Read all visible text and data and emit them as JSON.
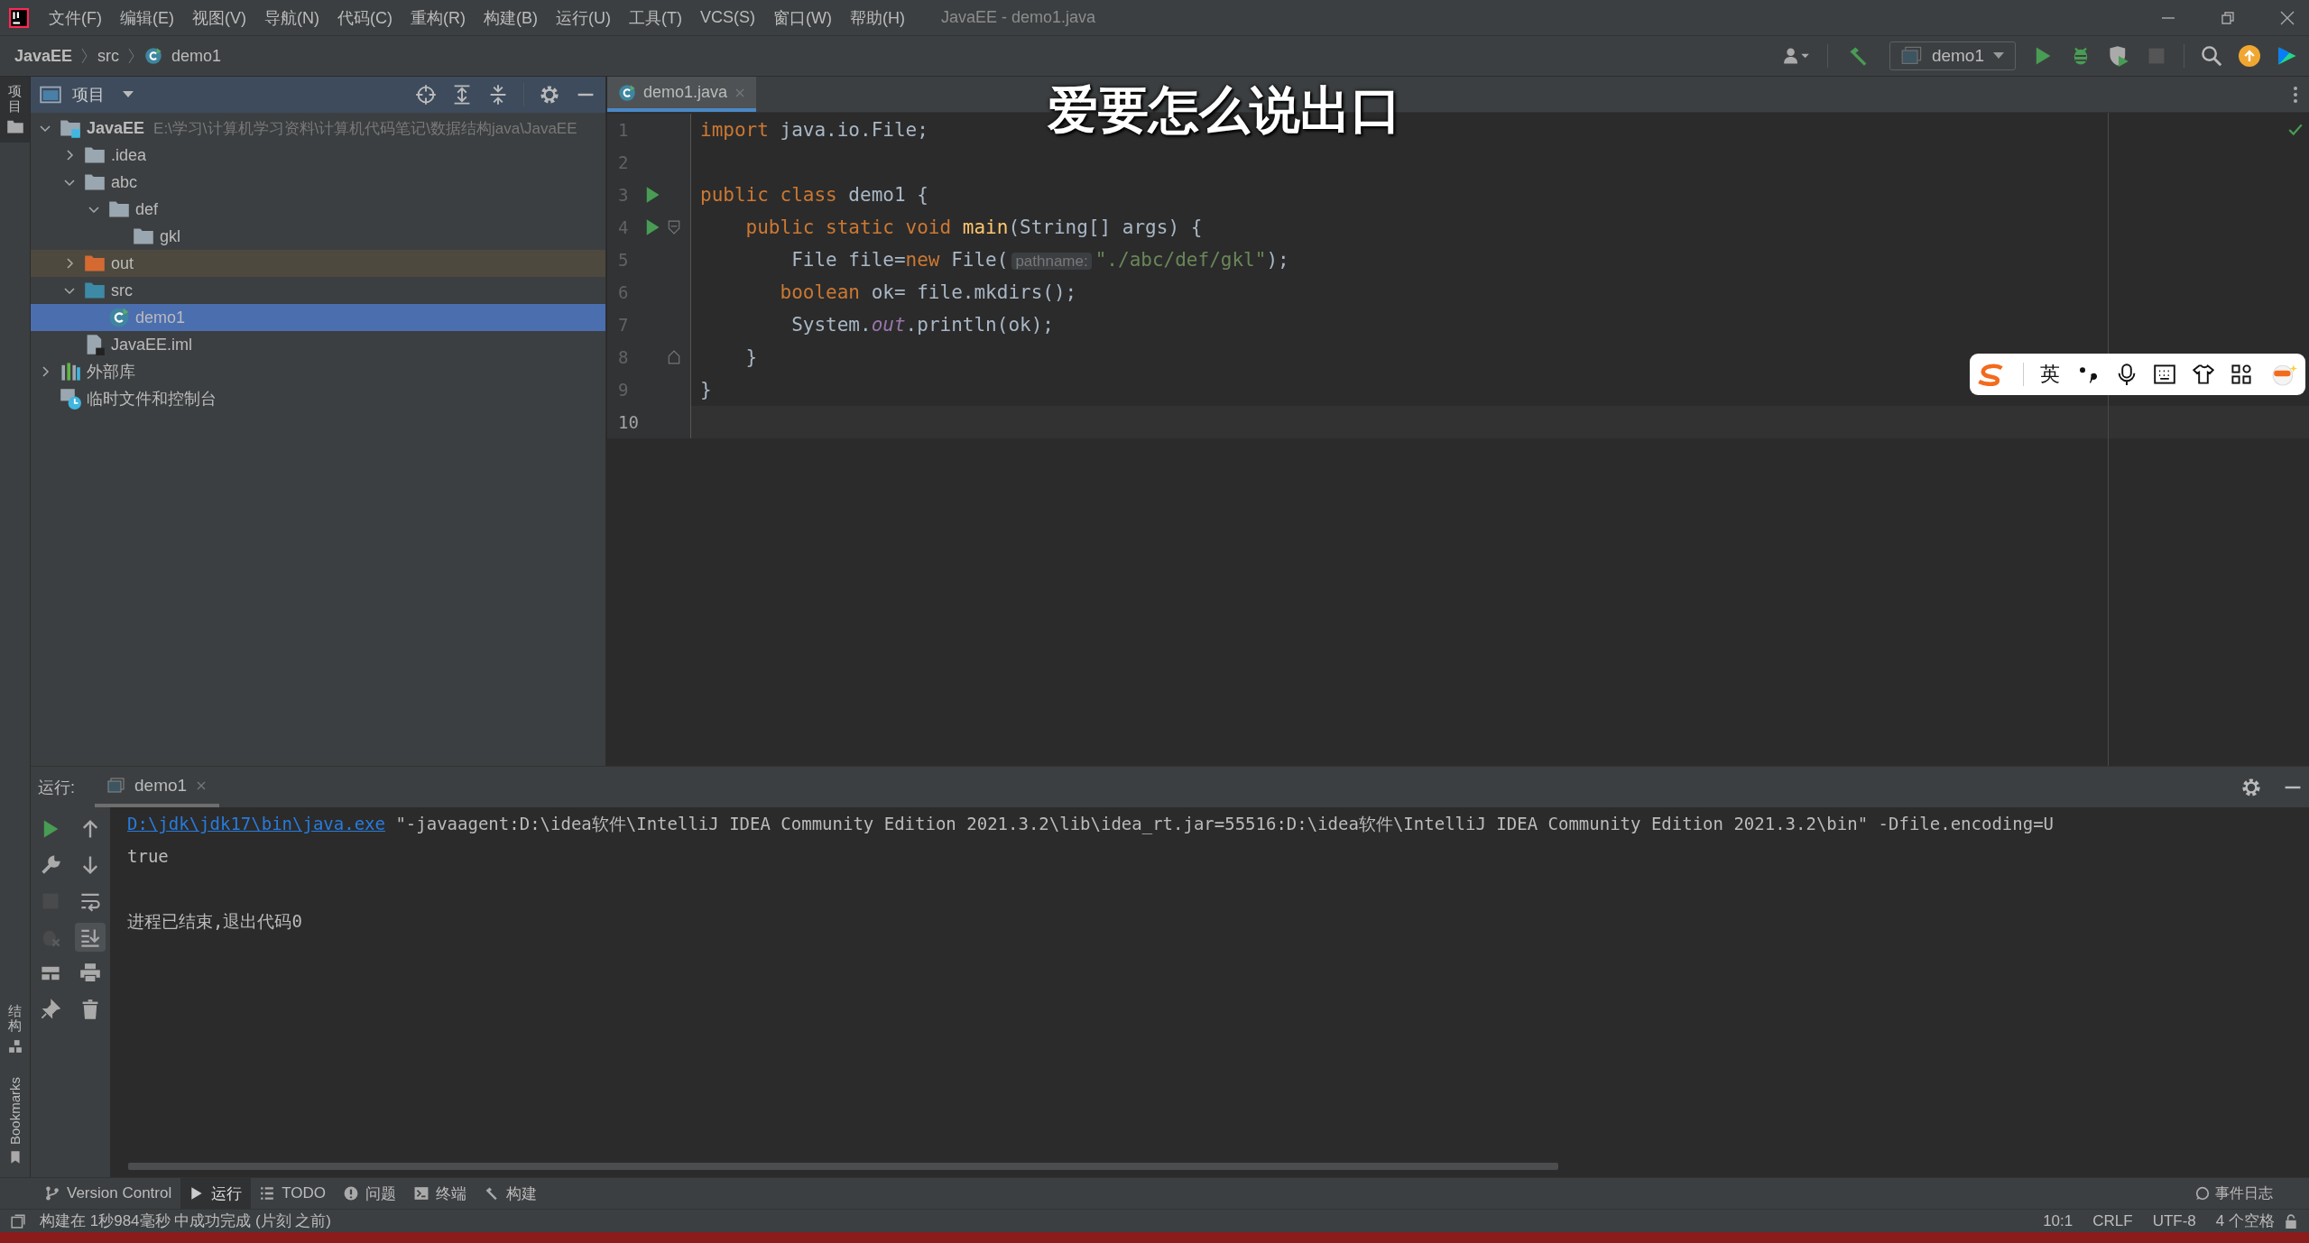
{
  "title_bar": {
    "menu": [
      "文件(F)",
      "编辑(E)",
      "视图(V)",
      "导航(N)",
      "代码(C)",
      "重构(R)",
      "构建(B)",
      "运行(U)",
      "工具(T)",
      "VCS(S)",
      "窗口(W)",
      "帮助(H)"
    ],
    "title": "JavaEE - demo1.java"
  },
  "nav_bar": {
    "breadcrumbs": [
      {
        "label": "JavaEE",
        "kind": "module"
      },
      {
        "label": "src",
        "kind": "folder"
      },
      {
        "label": "demo1",
        "kind": "class"
      }
    ],
    "run_config": "demo1"
  },
  "left_stripe": {
    "top": "项目",
    "bottom": [
      {
        "label": "结构",
        "kind": "cjk"
      },
      {
        "label": "Bookmarks",
        "kind": "latin"
      }
    ]
  },
  "project": {
    "title": "项目",
    "tree": [
      {
        "label": "JavaEE",
        "path": "E:\\学习\\计算机学习资料\\计算机代码笔记\\数据结构java\\JavaEE",
        "kind": "module",
        "expanded": true,
        "selected": false,
        "children": [
          {
            "label": ".idea",
            "kind": "folder",
            "expanded": false,
            "selected": false
          },
          {
            "label": "abc",
            "kind": "folder",
            "expanded": true,
            "selected": false,
            "children": [
              {
                "label": "def",
                "kind": "folder",
                "expanded": true,
                "selected": false,
                "children": [
                  {
                    "label": "gkl",
                    "kind": "folder",
                    "selected": false
                  }
                ]
              }
            ]
          },
          {
            "label": "out",
            "kind": "excluded",
            "expanded": false,
            "selected": false
          },
          {
            "label": "src",
            "kind": "source",
            "expanded": true,
            "selected": false,
            "children": [
              {
                "label": "demo1",
                "kind": "class",
                "selected": true
              }
            ]
          },
          {
            "label": "JavaEE.iml",
            "kind": "iml",
            "selected": false
          }
        ]
      },
      {
        "label": "外部库",
        "kind": "library",
        "expanded": false,
        "selected": false
      },
      {
        "label": "临时文件和控制台",
        "kind": "scratch",
        "selected": false
      }
    ]
  },
  "editor": {
    "tabs": [
      {
        "label": "demo1.java",
        "selected": true
      }
    ],
    "caption": "爱要怎么说出口",
    "lines": [
      {
        "number": "1",
        "current": false,
        "tokens": [
          {
            "kind": "keyword",
            "text": "import"
          },
          {
            "kind": "plain",
            "text": " java.io.File;"
          }
        ]
      },
      {
        "number": "2",
        "current": false
      },
      {
        "number": "3",
        "current": false,
        "run": true,
        "tokens": [
          {
            "kind": "keyword",
            "text": "public class"
          },
          {
            "kind": "plain",
            "text": " demo1 {"
          }
        ]
      },
      {
        "number": "4",
        "current": false,
        "run": true,
        "fold_start": true,
        "tokens": [
          {
            "kind": "keyword",
            "text": "    public static void "
          },
          {
            "kind": "method",
            "text": "main"
          },
          {
            "kind": "plain",
            "text": "(String[] args) {"
          }
        ]
      },
      {
        "number": "5",
        "current": false,
        "tokens": [
          {
            "kind": "plain",
            "text": "        File file="
          },
          {
            "kind": "keyword",
            "text": "new"
          },
          {
            "kind": "plain",
            "text": " File("
          },
          {
            "kind": "hint",
            "text": "pathname:"
          },
          {
            "kind": "string",
            "text": "\"./abc/def/gkl\""
          },
          {
            "kind": "plain",
            "text": ");"
          }
        ]
      },
      {
        "number": "6",
        "current": false,
        "tokens": [
          {
            "kind": "keyword",
            "text": "       boolean"
          },
          {
            "kind": "plain",
            "text": " ok= file.mkdirs();"
          }
        ]
      },
      {
        "number": "7",
        "current": false,
        "tokens": [
          {
            "kind": "plain",
            "text": "        System."
          },
          {
            "kind": "field",
            "text": "out"
          },
          {
            "kind": "plain",
            "text": ".println(ok);"
          }
        ]
      },
      {
        "number": "8",
        "current": false,
        "fold_end": true,
        "tokens": [
          {
            "kind": "plain",
            "text": "    }"
          }
        ]
      },
      {
        "number": "9",
        "current": false,
        "tokens": [
          {
            "kind": "plain",
            "text": "}"
          }
        ]
      },
      {
        "number": "10",
        "current": true
      }
    ]
  },
  "ime_bar": {
    "mode": "英"
  },
  "run_panel": {
    "label": "运行:",
    "tabs": [
      {
        "label": "demo1",
        "selected": true
      }
    ],
    "left_tools": [
      {
        "kind": "run",
        "disabled": false
      },
      {
        "kind": "wrench",
        "disabled": false
      },
      {
        "kind": "stop",
        "disabled": true
      },
      {
        "kind": "debug",
        "disabled": true
      },
      {
        "kind": "layout",
        "disabled": false
      },
      {
        "kind": "pin",
        "disabled": false
      }
    ],
    "right_tools": [
      {
        "kind": "up",
        "on": false
      },
      {
        "kind": "down",
        "on": false
      },
      {
        "kind": "wrap",
        "on": false
      },
      {
        "kind": "scroll-end",
        "on": true
      },
      {
        "kind": "print",
        "on": false
      },
      {
        "kind": "trash",
        "on": false
      }
    ],
    "output": [
      {
        "kind": "command",
        "link": "D:\\jdk\\jdk17\\bin\\java.exe",
        "text": " \"-javaagent:D:\\idea软件\\IntelliJ IDEA Community Edition 2021.3.2\\lib\\idea_rt.jar=55516:D:\\idea软件\\IntelliJ IDEA Community Edition 2021.3.2\\bin\" -Dfile.encoding=U"
      },
      {
        "kind": "plain",
        "text": "true"
      },
      {
        "kind": "exit",
        "text": "进程已结束,退出代码0"
      }
    ]
  },
  "tool_tabs": [
    {
      "label": "Version Control",
      "kind": "branch",
      "selected": false
    },
    {
      "label": "运行",
      "kind": "play",
      "selected": true
    },
    {
      "label": "TODO",
      "kind": "list",
      "selected": false
    },
    {
      "label": "问题",
      "kind": "alert",
      "selected": false
    },
    {
      "label": "终端",
      "kind": "terminal",
      "selected": false
    },
    {
      "label": "构建",
      "kind": "hammer",
      "selected": false
    }
  ],
  "status_bar": {
    "message": "构建在 1秒984毫秒 中成功完成 (片刻 之前)",
    "event_log": "事件日志",
    "position": "10:1",
    "line_ending": "CRLF",
    "encoding": "UTF-8",
    "indent": "4 个空格"
  }
}
